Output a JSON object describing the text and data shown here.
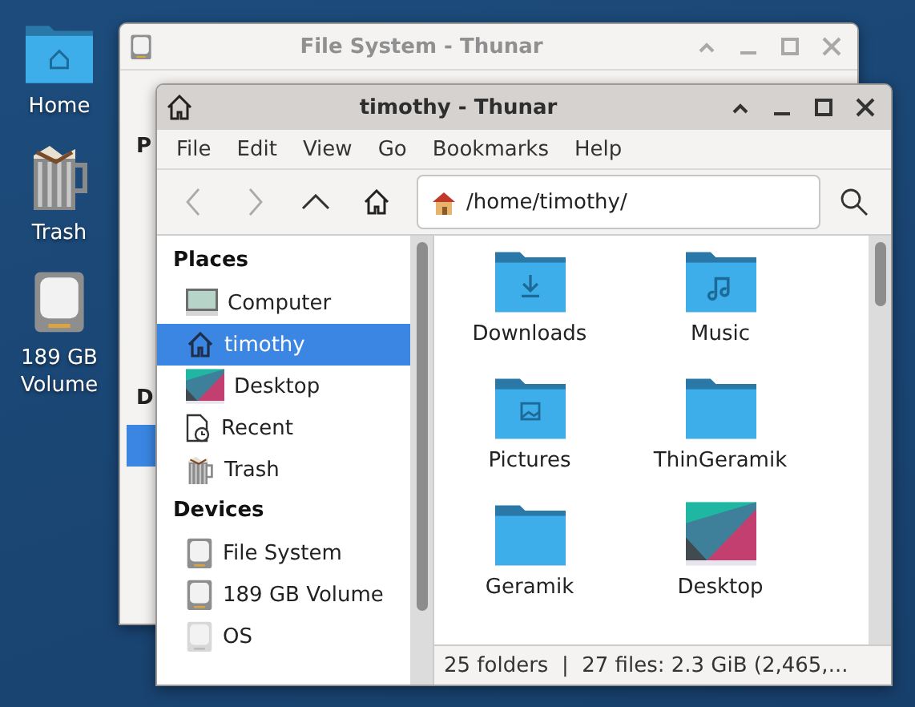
{
  "desktop_icons": [
    {
      "label": "Home",
      "kind": "home-folder"
    },
    {
      "label": "Trash",
      "kind": "trash"
    },
    {
      "label": "189 GB Volume",
      "kind": "drive"
    }
  ],
  "back_window": {
    "title": "File System - Thunar",
    "sidebar_fragments": [
      "P",
      "D"
    ]
  },
  "window": {
    "title": "timothy - Thunar"
  },
  "menu": [
    "File",
    "Edit",
    "View",
    "Go",
    "Bookmarks",
    "Help"
  ],
  "location": "/home/timothy/",
  "sidebar": [
    {
      "heading": "Places",
      "items": [
        {
          "label": "Computer",
          "kind": "computer",
          "selected": false
        },
        {
          "label": "timothy",
          "kind": "home",
          "selected": true
        },
        {
          "label": "Desktop",
          "kind": "wallpaper",
          "selected": false
        },
        {
          "label": "Recent",
          "kind": "recent",
          "selected": false
        },
        {
          "label": "Trash",
          "kind": "trash",
          "selected": false
        }
      ]
    },
    {
      "heading": "Devices",
      "items": [
        {
          "label": "File System",
          "kind": "drive",
          "selected": false
        },
        {
          "label": "189 GB Volume",
          "kind": "drive",
          "selected": false
        },
        {
          "label": "OS",
          "kind": "removable",
          "selected": false
        }
      ]
    }
  ],
  "files": [
    {
      "name": "Downloads",
      "kind": "downloads"
    },
    {
      "name": "Music",
      "kind": "music"
    },
    {
      "name": "Pictures",
      "kind": "pictures"
    },
    {
      "name": "ThinGeramik",
      "kind": "folder"
    },
    {
      "name": "Geramik",
      "kind": "folder"
    },
    {
      "name": "Desktop",
      "kind": "wallpaper"
    }
  ],
  "status_bar": "25 folders  |  27 files: 2.3 GiB (2,465,..."
}
